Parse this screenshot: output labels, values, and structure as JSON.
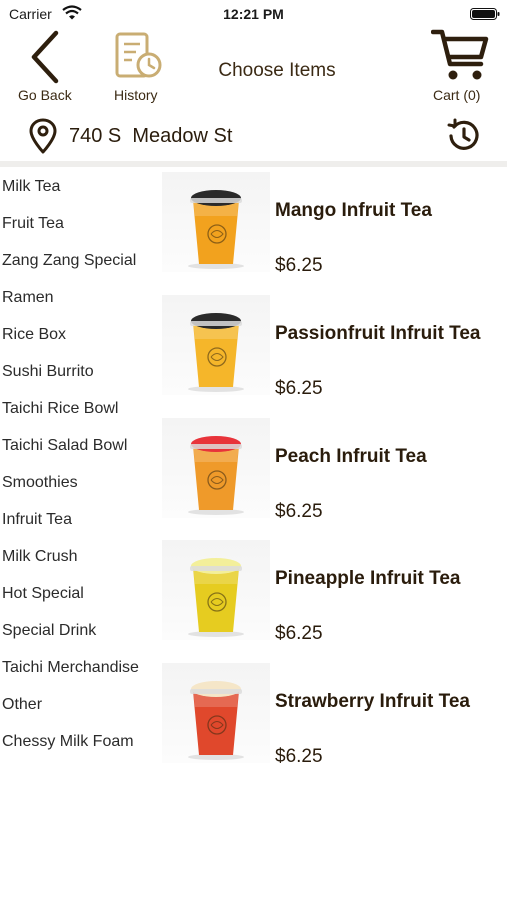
{
  "status_bar": {
    "carrier": "Carrier",
    "time": "12:21 PM"
  },
  "nav": {
    "back_label": "Go Back",
    "history_label": "History",
    "title": "Choose Items",
    "cart_label": "Cart (0)"
  },
  "location": {
    "address": "740 S  Meadow St"
  },
  "categories": [
    "Milk Tea",
    "Fruit Tea",
    "Zang Zang Special",
    "Ramen",
    "Rice Box",
    "Sushi Burrito",
    "Taichi Rice Bowl",
    "Taichi Salad Bowl",
    "Smoothies",
    "Infruit Tea",
    "Milk Crush",
    "Hot Special",
    "Special Drink",
    "Taichi Merchandise",
    "Other",
    "Chessy Milk Foam"
  ],
  "products": [
    {
      "name": "Mango Infruit Tea",
      "price": "$6.25",
      "drink_color": "#f2a21e",
      "topping_color": "#2a2a2a"
    },
    {
      "name": "Passionfruit Infruit Tea",
      "price": "$6.25",
      "drink_color": "#f5b62a",
      "topping_color": "#2a2a2a"
    },
    {
      "name": "Peach Infruit Tea",
      "price": "$6.25",
      "drink_color": "#ef9a2a",
      "topping_color": "#e8333a"
    },
    {
      "name": "Pineapple Infruit Tea",
      "price": "$6.25",
      "drink_color": "#e6cc20",
      "topping_color": "#f3ef9a"
    },
    {
      "name": "Strawberry Infruit Tea",
      "price": "$6.25",
      "drink_color": "#e0482c",
      "topping_color": "#f5e6c8"
    }
  ],
  "colors": {
    "brand_brown": "#4a3414",
    "divider": "#efeeec"
  }
}
